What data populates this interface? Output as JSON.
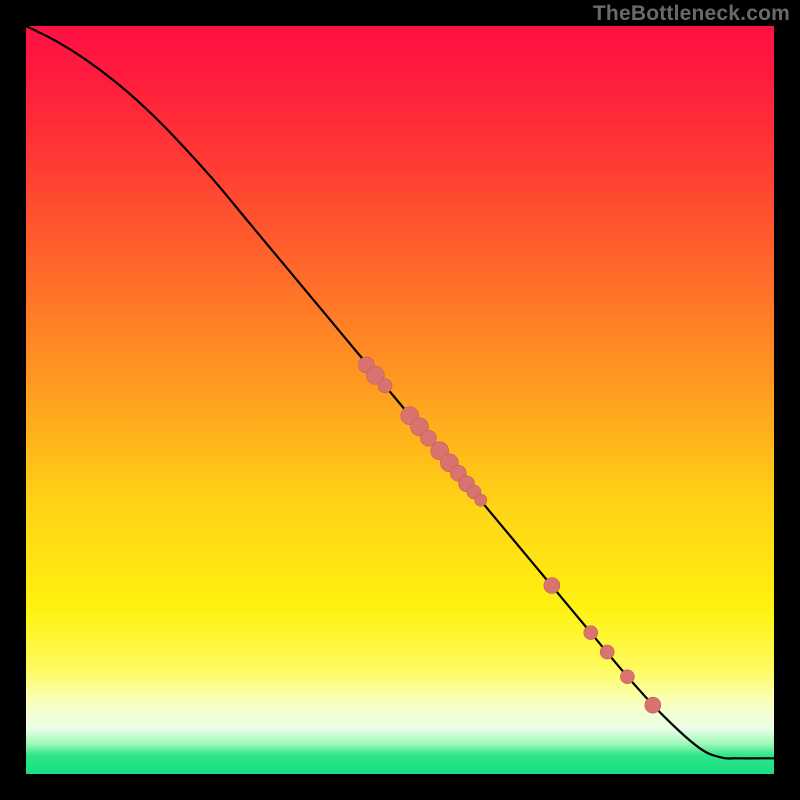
{
  "watermark": "TheBottleneck.com",
  "colors": {
    "dot_fill": "#d9736f",
    "dot_stroke": "#c55c58",
    "curve": "#000000"
  },
  "chart_data": {
    "type": "line",
    "title": "",
    "xlabel": "",
    "ylabel": "",
    "xlim": [
      0,
      100
    ],
    "ylim": [
      0,
      100
    ],
    "grid": false,
    "legend": false,
    "series": [
      {
        "name": "curve",
        "kind": "line",
        "x": [
          0,
          4,
          8,
          12,
          16,
          20,
          25,
          30,
          35,
          40,
          45,
          50,
          55,
          60,
          65,
          70,
          75,
          80,
          85,
          90,
          93,
          95,
          100
        ],
        "y": [
          100,
          98,
          95.5,
          92.5,
          89,
          85,
          79.5,
          73.5,
          67.5,
          61.5,
          55.5,
          49.5,
          43.5,
          37.5,
          31.5,
          25.5,
          19.5,
          13.5,
          8,
          3.5,
          2.2,
          2.1,
          2.1
        ]
      },
      {
        "name": "points",
        "kind": "scatter",
        "points": [
          {
            "x": 45.5,
            "y": 54.7,
            "r": 8
          },
          {
            "x": 46.7,
            "y": 53.3,
            "r": 9
          },
          {
            "x": 48.0,
            "y": 51.9,
            "r": 7
          },
          {
            "x": 51.3,
            "y": 47.9,
            "r": 9
          },
          {
            "x": 52.6,
            "y": 46.4,
            "r": 9
          },
          {
            "x": 53.8,
            "y": 44.9,
            "r": 8
          },
          {
            "x": 55.3,
            "y": 43.2,
            "r": 9
          },
          {
            "x": 56.6,
            "y": 41.6,
            "r": 9
          },
          {
            "x": 57.8,
            "y": 40.2,
            "r": 8
          },
          {
            "x": 58.9,
            "y": 38.8,
            "r": 8
          },
          {
            "x": 59.9,
            "y": 37.7,
            "r": 7
          },
          {
            "x": 60.8,
            "y": 36.6,
            "r": 6
          },
          {
            "x": 70.3,
            "y": 25.2,
            "r": 8
          },
          {
            "x": 75.5,
            "y": 18.9,
            "r": 7
          },
          {
            "x": 77.7,
            "y": 16.3,
            "r": 7
          },
          {
            "x": 80.4,
            "y": 13.0,
            "r": 7
          },
          {
            "x": 83.8,
            "y": 9.2,
            "r": 8
          }
        ]
      }
    ]
  }
}
